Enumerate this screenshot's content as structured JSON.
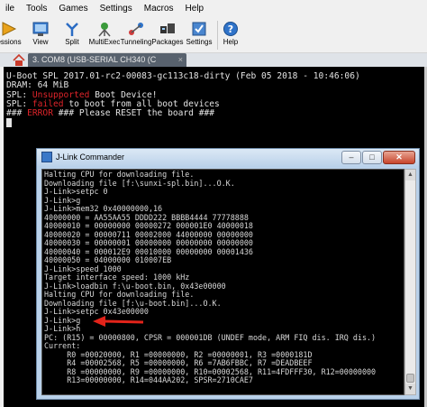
{
  "menu": [
    "ile",
    "Tools",
    "Games",
    "Settings",
    "Macros",
    "Help"
  ],
  "toolbar": [
    {
      "label": "essions",
      "icon": "sessions-icon"
    },
    {
      "label": "View",
      "icon": "view-icon"
    },
    {
      "label": "Split",
      "icon": "split-icon"
    },
    {
      "label": "MultiExec",
      "icon": "multiexec-icon"
    },
    {
      "label": "Tunneling",
      "icon": "tunneling-icon"
    },
    {
      "label": "Packages",
      "icon": "packages-icon"
    },
    {
      "label": "Settings",
      "icon": "settings-icon"
    },
    {
      "label": "Help",
      "icon": "help-icon"
    }
  ],
  "tab": {
    "title": "3. COM8  (USB-SERIAL CH340 (C",
    "close": "×"
  },
  "terminal": [
    {
      "a": "U-Boot SPL 2017.01-rc2-00083-gc113c18-dirty (Feb 05 2018 - 10:46:06)"
    },
    {
      "a": "DRAM: 64 MiB"
    },
    {
      "a": "SPL: ",
      "r": "Unsupported",
      "b": " Boot Device!"
    },
    {
      "a": "SPL: ",
      "r": "failed",
      "b": " to boot from all boot devices"
    },
    {
      "a": "### ",
      "r": "ERROR",
      "b": " ### Please RESET the board ###"
    }
  ],
  "jlink": {
    "title": "J-Link Commander",
    "buttons": {
      "minimize": "–",
      "maximize": "□",
      "close": "✕"
    },
    "lines": [
      "Halting CPU for downloading file.",
      "Downloading file [f:\\sunxi-spl.bin]...O.K.",
      "J-Link>setpc 0",
      "J-Link>g",
      "J-Link>mem32 0x40000000,16",
      "40000000 = AA55AA55 DDDD222 BBBB4444 77778888",
      "40000010 = 00000000 00000272 000001E0 40000018",
      "40000020 = 00000711 00002000 44000000 00000000",
      "40000030 = 00000001 00000000 00000000 00000000",
      "40000040 = 000012E9 00010000 00000000 00001436",
      "40000050 = 04000000 010007EB",
      "J-Link>speed 1000",
      "Target interface speed: 1000 kHz",
      "J-Link>loadbin f:\\u-boot.bin, 0x43e00000",
      "Halting CPU for downloading file.",
      "Downloading file [f:\\u-boot.bin]...O.K.",
      "J-Link>setpc 0x43e00000",
      "J-Link>g",
      "J-Link>h",
      "PC: (R15) = 00000800, CPSR = 000001DB (UNDEF mode, ARM FIQ dis. IRQ dis.)",
      "Current:",
      "     R0 =00020000, R1 =00000000, R2 =00000001, R3 =0000181D",
      "     R4 =00002568, R5 =00000000, R6 =7AB6FBBC, R7 =DEADBEEF",
      "     R8 =00000000, R9 =00000000, R10=00002568, R11=4FDFFF30, R12=00000000",
      "     R13=00000000, R14=044AA202, SPSR=2710CAE7"
    ]
  },
  "colors": {
    "terminal_bg": "#000000",
    "error_red": "#e0242a",
    "annotation_arrow": "#e2231a"
  }
}
